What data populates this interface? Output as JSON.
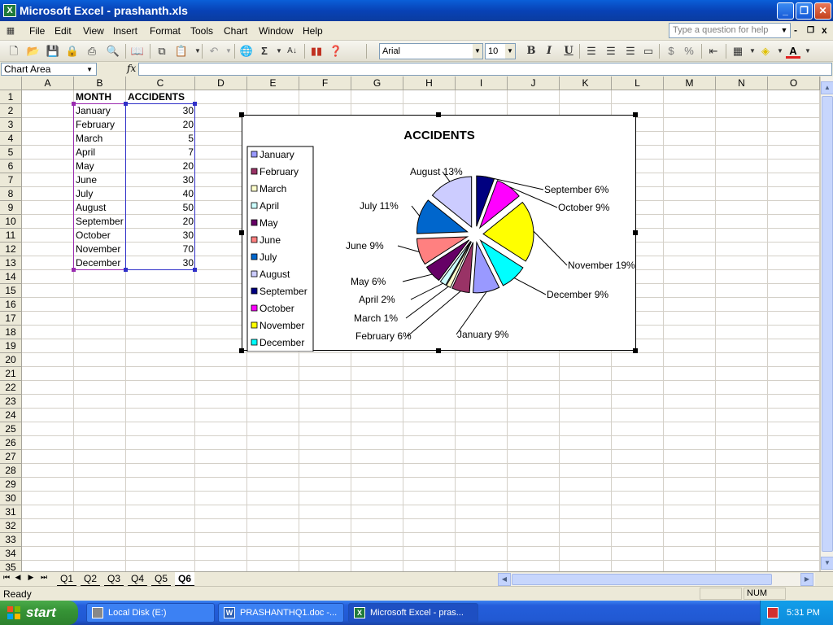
{
  "window": {
    "title": "Microsoft Excel - prashanth.xls",
    "app_icon": "X",
    "min_label": "_",
    "max_label": "❐",
    "close_label": "✕"
  },
  "menu": {
    "items": [
      "File",
      "Edit",
      "View",
      "Insert",
      "Format",
      "Tools",
      "Chart",
      "Window",
      "Help"
    ],
    "help_placeholder": "Type a question for help",
    "mdi_min": "-",
    "mdi_restore": "❐",
    "mdi_close": "x"
  },
  "toolbar": {
    "font_name": "Arial",
    "font_size": "10",
    "bold": "B",
    "italic": "I",
    "underline": "U",
    "currency": "$",
    "percent": "%",
    "sigma": "Σ",
    "font_color_letter": "A"
  },
  "formula_bar": {
    "name_box": "Chart Area",
    "fx": "fx",
    "value": ""
  },
  "grid": {
    "columns": [
      "A",
      "B",
      "C",
      "D",
      "E",
      "F",
      "G",
      "H",
      "I",
      "J",
      "K",
      "L",
      "M",
      "N",
      "O"
    ],
    "rows": [
      "1",
      "2",
      "3",
      "4",
      "5",
      "6",
      "7",
      "8",
      "9",
      "10",
      "11",
      "12",
      "13",
      "14",
      "15",
      "16",
      "17",
      "18",
      "19",
      "20",
      "21",
      "22",
      "23",
      "24",
      "25",
      "26",
      "27",
      "28",
      "29",
      "30",
      "31",
      "32",
      "33",
      "34",
      "35"
    ],
    "header_month": "MONTH",
    "header_accidents": "ACCIDENTS",
    "data": [
      {
        "month": "January",
        "value": "30"
      },
      {
        "month": "February",
        "value": "20"
      },
      {
        "month": "March",
        "value": "5"
      },
      {
        "month": "April",
        "value": "7"
      },
      {
        "month": "May",
        "value": "20"
      },
      {
        "month": "June",
        "value": "30"
      },
      {
        "month": "July",
        "value": "40"
      },
      {
        "month": "August",
        "value": "50"
      },
      {
        "month": "September",
        "value": "20"
      },
      {
        "month": "October",
        "value": "30"
      },
      {
        "month": "November",
        "value": "70"
      },
      {
        "month": "December",
        "value": "30"
      }
    ]
  },
  "chart_data": {
    "type": "pie",
    "title": "ACCIDENTS",
    "categories": [
      "January",
      "February",
      "March",
      "April",
      "May",
      "June",
      "July",
      "August",
      "September",
      "October",
      "November",
      "December"
    ],
    "values": [
      30,
      20,
      5,
      7,
      20,
      30,
      40,
      50,
      20,
      30,
      70,
      30
    ],
    "labels": [
      "January 9%",
      "February 6%",
      "March 1%",
      "April 2%",
      "May 6%",
      "June 9%",
      "July 11%",
      "August 13%",
      "September 6%",
      "October 9%",
      "November 19%",
      "December 9%"
    ],
    "colors": [
      "#9999ff",
      "#993366",
      "#ffffcc",
      "#ccffff",
      "#660066",
      "#ff8080",
      "#0066cc",
      "#ccccff",
      "#000080",
      "#ff00ff",
      "#ffff00",
      "#00ffff"
    ],
    "legend_position": "left",
    "exploded": true
  },
  "sheet_tabs": {
    "tabs": [
      "Q1",
      "Q2",
      "Q3",
      "Q4",
      "Q5",
      "Q6"
    ],
    "active": "Q6"
  },
  "status": {
    "ready": "Ready",
    "num": "NUM"
  },
  "taskbar": {
    "start": "start",
    "tasks": [
      "Local Disk (E:)",
      "PRASHANTHQ1.doc -...",
      "Microsoft Excel - pras..."
    ],
    "clock": "5:31 PM"
  }
}
